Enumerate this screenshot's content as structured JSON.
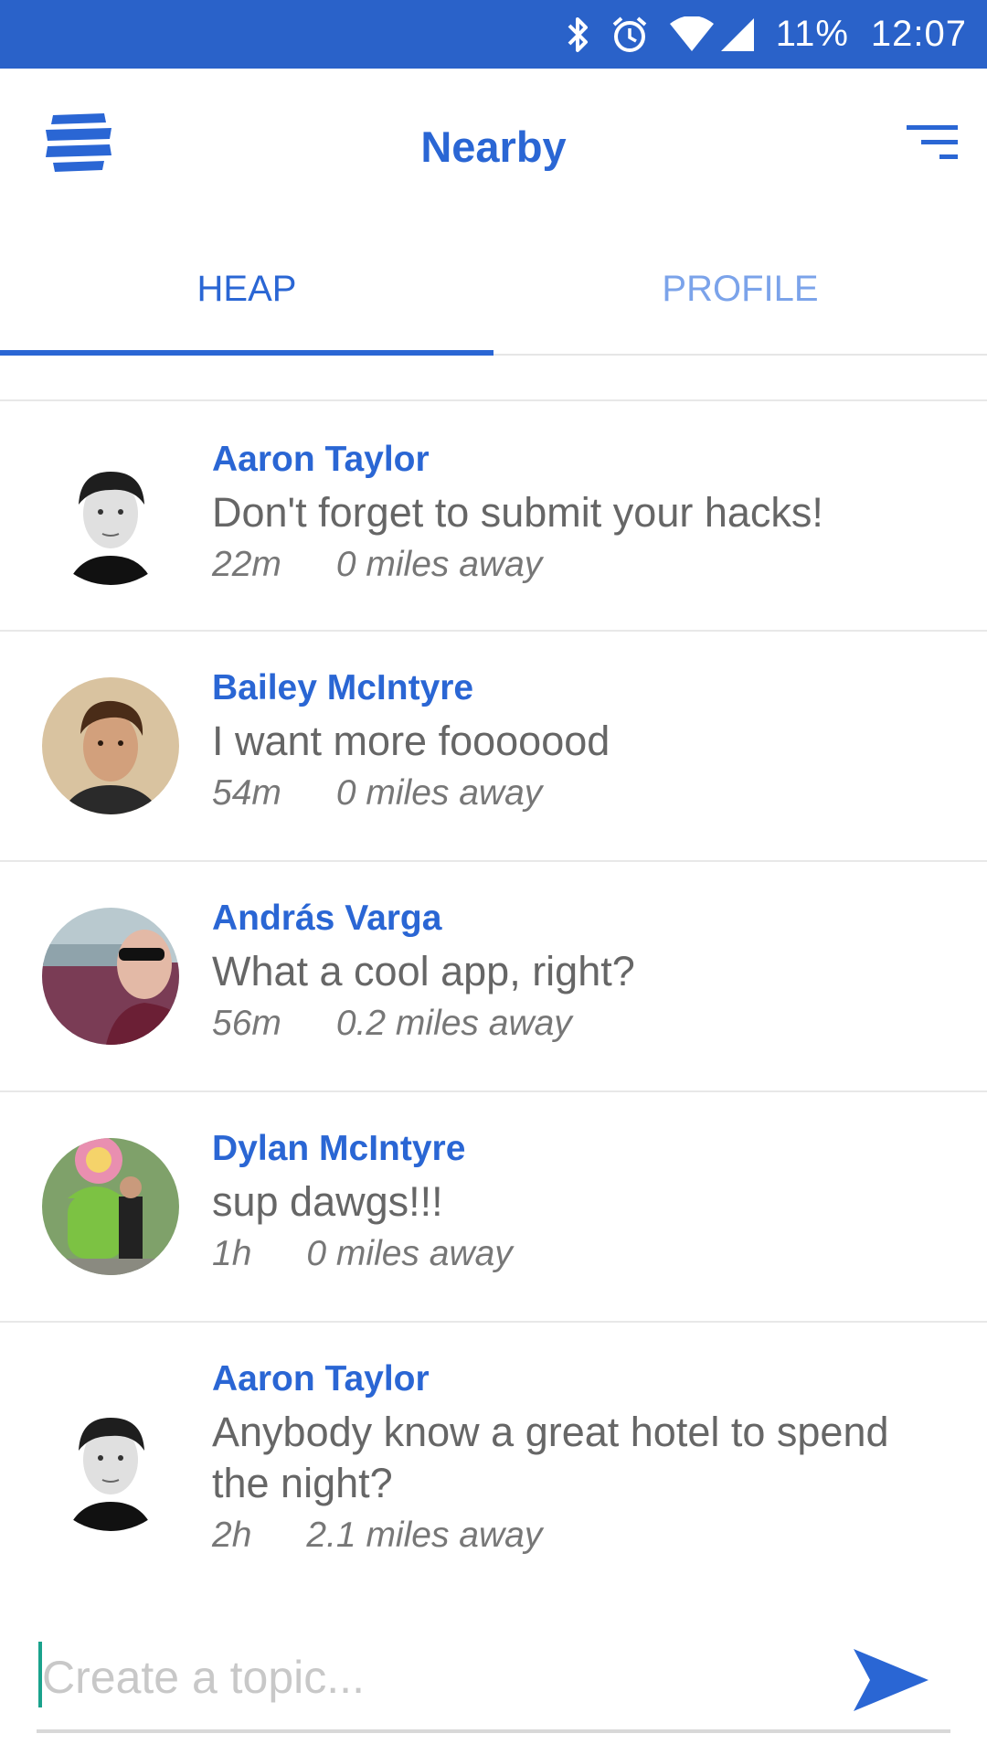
{
  "status_bar": {
    "battery": "11%",
    "time": "12:07",
    "icons": [
      "bluetooth-icon",
      "alarm-icon",
      "wifi-icon",
      "signal-icon"
    ],
    "background": "#2a62c9"
  },
  "app_bar": {
    "title": "Nearby",
    "logo_icon": "app-logo-icon",
    "menu_icon": "filter-menu-icon",
    "accent": "#2a66d4"
  },
  "tabs": [
    {
      "label": "HEAP",
      "selected": true
    },
    {
      "label": "PROFILE",
      "selected": false
    }
  ],
  "posts": [
    {
      "author": "Aaron Taylor",
      "message": "Don't forget to submit your hacks!",
      "age": "22m",
      "distance": "0 miles away"
    },
    {
      "author": "Bailey McIntyre",
      "message": "I want more fooooood",
      "age": "54m",
      "distance": "0 miles away"
    },
    {
      "author": "András Varga",
      "message": "What a cool app, right?",
      "age": "56m",
      "distance": "0.2 miles away"
    },
    {
      "author": "Dylan McIntyre",
      "message": "sup dawgs!!!",
      "age": "1h",
      "distance": "0 miles away"
    },
    {
      "author": "Aaron Taylor",
      "message": "Anybody know a great hotel to spend the night?",
      "age": "2h",
      "distance": "2.1 miles away"
    }
  ],
  "composer": {
    "placeholder": "Create a topic...",
    "value": "",
    "send_icon": "send-icon"
  }
}
